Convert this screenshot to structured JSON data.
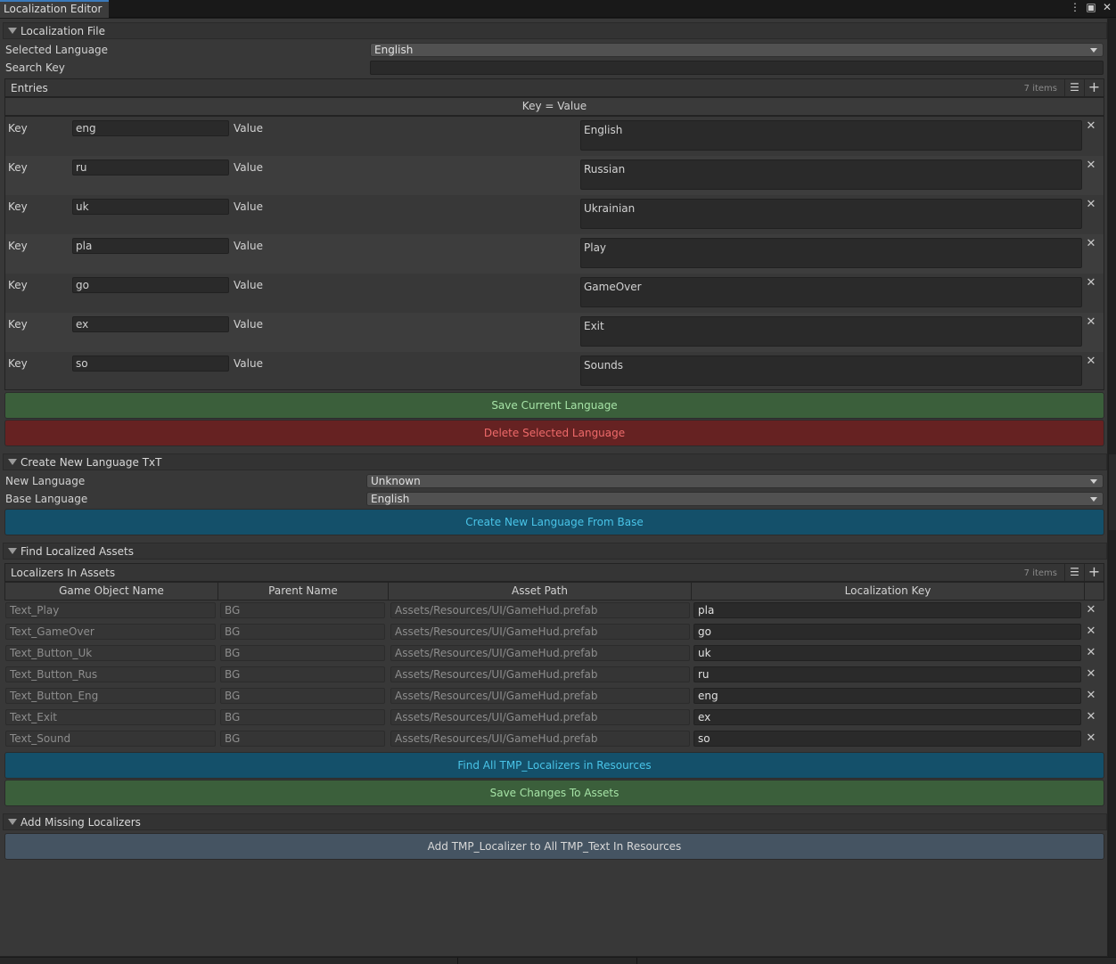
{
  "window": {
    "tab_title": "Localization Editor",
    "icons": [
      "kebab-menu-icon",
      "maximize-icon",
      "close-icon"
    ]
  },
  "localization_file": {
    "header": "Localization File",
    "selected_language_label": "Selected Language",
    "selected_language_value": "English",
    "search_key_label": "Search Key",
    "search_key_value": ""
  },
  "entries": {
    "title": "Entries",
    "count": "7 items",
    "column_header": "Key = Value",
    "key_label": "Key",
    "value_label": "Value",
    "rows": [
      {
        "key": "eng",
        "value": "English"
      },
      {
        "key": "ru",
        "value": "Russian"
      },
      {
        "key": "uk",
        "value": "Ukrainian"
      },
      {
        "key": "pla",
        "value": "Play"
      },
      {
        "key": "go",
        "value": "GameOver"
      },
      {
        "key": "ex",
        "value": "Exit"
      },
      {
        "key": "so",
        "value": "Sounds"
      }
    ]
  },
  "buttons": {
    "save_current_language": "Save Current Language",
    "delete_selected_language": "Delete Selected Language",
    "create_new_language": "Create New Language From Base",
    "find_all": "Find All TMP_Localizers in Resources",
    "save_changes": "Save Changes To Assets",
    "add_localizer": "Add TMP_Localizer to All TMP_Text In Resources"
  },
  "create_language": {
    "header": "Create New Language TxT",
    "new_language_label": "New Language",
    "new_language_value": "Unknown",
    "base_language_label": "Base Language",
    "base_language_value": "English"
  },
  "find_assets": {
    "header": "Find Localized Assets",
    "list_title": "Localizers In Assets",
    "count": "7 items",
    "columns": [
      "Game Object Name",
      "Parent Name",
      "Asset Path",
      "Localization Key"
    ],
    "rows": [
      {
        "name": "Text_Play",
        "parent": "BG",
        "path": "Assets/Resources/UI/GameHud.prefab",
        "key": "pla"
      },
      {
        "name": "Text_GameOver",
        "parent": "BG",
        "path": "Assets/Resources/UI/GameHud.prefab",
        "key": "go"
      },
      {
        "name": "Text_Button_Uk",
        "parent": "BG",
        "path": "Assets/Resources/UI/GameHud.prefab",
        "key": "uk"
      },
      {
        "name": "Text_Button_Rus",
        "parent": "BG",
        "path": "Assets/Resources/UI/GameHud.prefab",
        "key": "ru"
      },
      {
        "name": "Text_Button_Eng",
        "parent": "BG",
        "path": "Assets/Resources/UI/GameHud.prefab",
        "key": "eng"
      },
      {
        "name": "Text_Exit",
        "parent": "BG",
        "path": "Assets/Resources/UI/GameHud.prefab",
        "key": "ex"
      },
      {
        "name": "Text_Sound",
        "parent": "BG",
        "path": "Assets/Resources/UI/GameHud.prefab",
        "key": "so"
      }
    ]
  },
  "add_missing": {
    "header": "Add Missing Localizers"
  },
  "colors": {
    "green_button": "#3b5f3b",
    "red_button": "#662222",
    "blue_button": "#14506a",
    "gray_button": "#455462"
  }
}
